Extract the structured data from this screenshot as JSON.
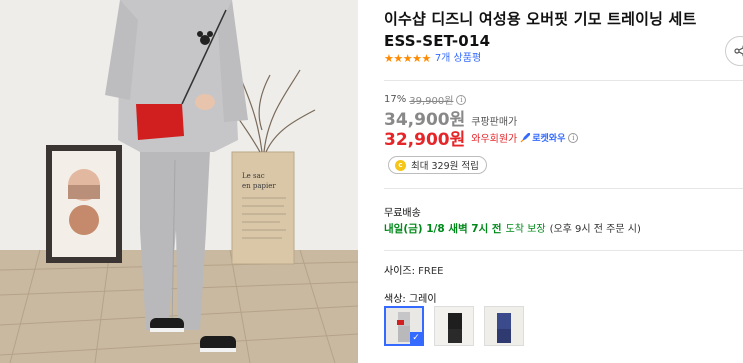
{
  "product": {
    "title": "이수샵 디즈니 여성용 오버핏 기모 트레이닝 세트 ESS-SET-014",
    "rating_stars": "★★★★★",
    "review_count": "7개 상품평"
  },
  "photo": {
    "poster_text_1": "Le sac",
    "poster_text_2": "en papier"
  },
  "pricing": {
    "discount_rate": "17%",
    "original_price": "39,900원",
    "sale_price": "34,900원",
    "sale_label": "쿠팡판매가",
    "member_price": "32,900원",
    "member_label": "와우회원가",
    "rocket_label": "로켓와우",
    "info_glyph": "i"
  },
  "points": {
    "coin_glyph": "c",
    "text": "최대 329원 적립"
  },
  "shipping": {
    "free_label": "무료배송",
    "arrival": "내일(금) 1/8 새벽 7시 전",
    "guarantee": "도착 보장",
    "cutoff": "(오후 9시 전 주문 시)"
  },
  "options": {
    "size_label": "사이즈: ",
    "size_value": "FREE",
    "color_label": "색상: 그레이",
    "check_glyph": "✓"
  },
  "colors": {
    "accent_blue": "#346aff",
    "member_red": "#e52528",
    "delivery_green": "#00891a",
    "star_orange": "#ff8a00"
  }
}
